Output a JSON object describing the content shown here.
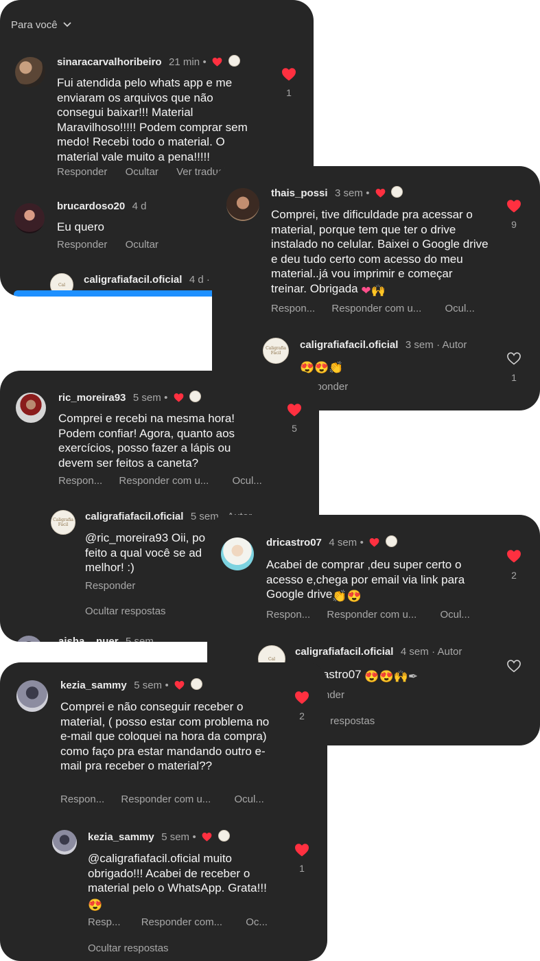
{
  "header": {
    "sort_label": "Para você"
  },
  "card1": {
    "c1": {
      "user": "sinaracarvalhoribeiro",
      "time": "21 min",
      "text": "Fui atendida pelo whats app e me enviaram os arquivos que não consegui baixar!!! Material Maravilhoso!!!!! Podem comprar sem medo! Recebi todo o material. O material vale muito a pena!!!!!",
      "reply": "Responder",
      "hide": "Ocultar",
      "translate": "Ver tradução",
      "likes": "1"
    },
    "c2": {
      "user": "brucardoso20",
      "time": "4 d",
      "text": "Eu quero",
      "reply": "Responder",
      "hide": "Ocultar"
    },
    "c3": {
      "user": "caligrafiafacil.oficial",
      "time": "4 d · A"
    }
  },
  "card2": {
    "c1": {
      "user": "thais_possi",
      "time": "3 sem",
      "text": "Comprei, tive dificuldade pra acessar o material,  porque tem que ter o drive instalado no celular.  Baixei o Google drive e deu tudo certo com acesso do meu material..já vou imprimir e começar treinar. Obrigada",
      "reply": "Respon...",
      "reply_with": "Responder com u...",
      "hide": "Ocul...",
      "likes": "9"
    },
    "c2": {
      "user": "caligrafiafacil.oficial",
      "time": "3 sem",
      "author": "Autor",
      "reply": "sponder",
      "likes": "1"
    }
  },
  "card3": {
    "c1": {
      "user": "ric_moreira93",
      "time": "5 sem",
      "text": "Comprei e recebi na mesma hora! Podem confiar! Agora, quanto aos exercícios, posso fazer a lápis ou devem ser feitos a caneta?",
      "reply": "Respon...",
      "reply_with": "Responder com u...",
      "hide": "Ocul...",
      "likes": "5"
    },
    "c2": {
      "user": "caligrafiafacil.oficial",
      "time": "5 sem · Autor",
      "text": "@ric_moreira93 Oii, po feito a qual você se ad melhor! :)",
      "reply": "Responder"
    },
    "hide_replies": "Ocultar respostas",
    "c3": {
      "user": "aisha__nuer",
      "time": "5 sem"
    }
  },
  "card4": {
    "c1": {
      "user": "dricastro07",
      "time": "4 sem",
      "text": "Acabei de comprar ,deu super certo o acesso  e,chega por email via link para Google drive",
      "reply": "Respon...",
      "reply_with": "Responder com u...",
      "hide": "Ocul...",
      "likes": "2"
    },
    "c2": {
      "user": "caligrafiafacil.oficial",
      "time": "4 sem",
      "author": "Autor",
      "text": "ricastro07",
      "reply": "nder"
    },
    "hide_replies": "r respostas"
  },
  "card5": {
    "c1": {
      "user": "kezia_sammy",
      "time": "5 sem",
      "text": "Comprei e não conseguir receber o material, ( posso estar com problema no e-mail que coloquei na hora da compra) como faço pra estar mandando outro e-mail pra receber o material??",
      "reply": "Respon...",
      "reply_with": "Responder com u...",
      "hide": "Ocul...",
      "likes": "2"
    },
    "c2": {
      "user": "kezia_sammy",
      "time": "5 sem",
      "text": "@caligrafiafacil.oficial muito obrigado!!! Acabei de receber o material pelo o WhatsApp. Grata!!!",
      "reply": "Resp...",
      "reply_with": "Responder com...",
      "hide": "Oc...",
      "likes": "1"
    },
    "hide_replies": "Ocultar respostas"
  },
  "logo_text": "Caligrafia Fácil",
  "colors": {
    "card_bg": "#262626",
    "like_red": "#ff3040",
    "muted": "#a8a8a8",
    "accent_blue": "#1e90ff"
  },
  "icons": [
    "chevron-down-icon",
    "heart-filled-icon",
    "heart-outline-icon",
    "avatar-icon"
  ]
}
